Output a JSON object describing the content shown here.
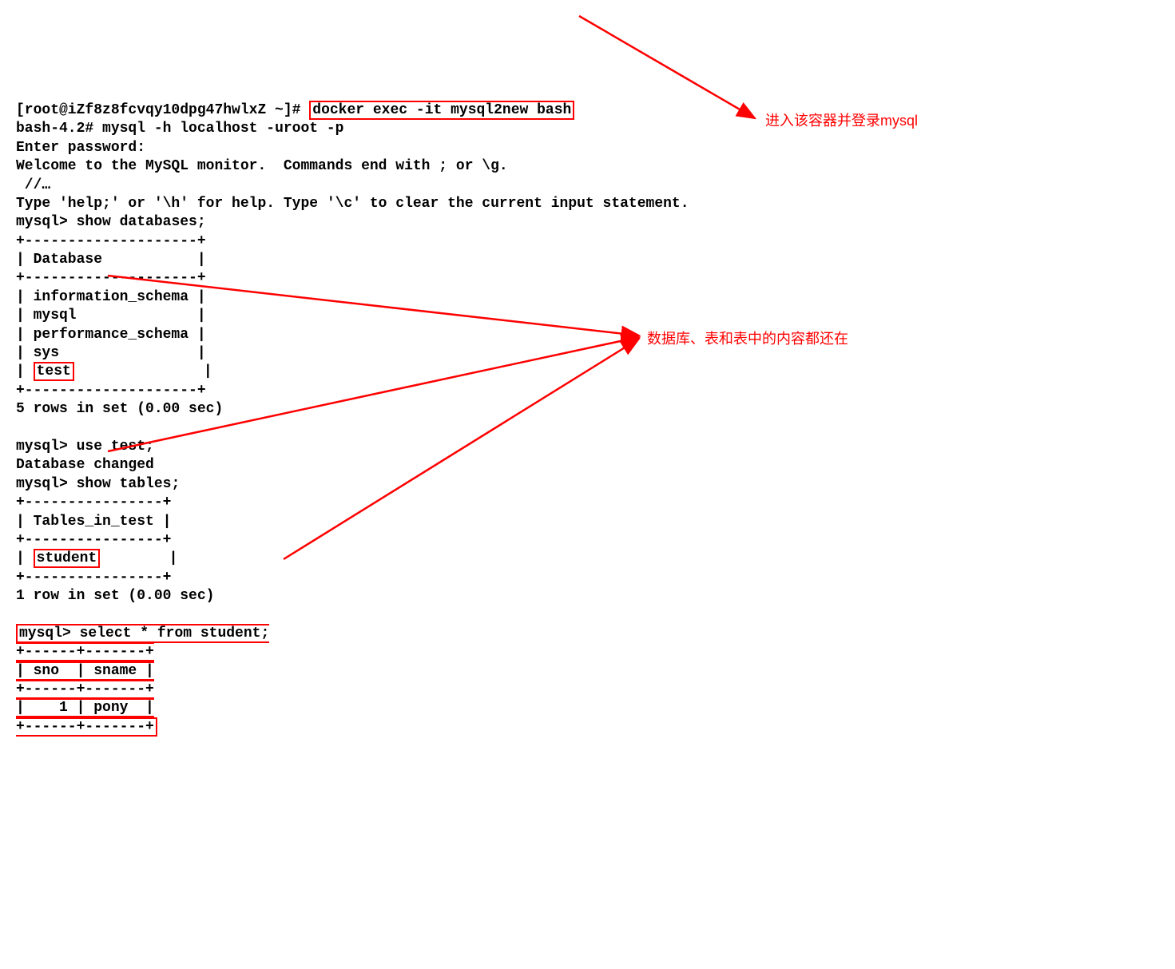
{
  "term": {
    "prompt1": "[root@iZf8z8fcvqy10dpg47hwlxZ ~]# ",
    "cmd1": "docker exec -it mysql2new bash",
    "bash_prompt": "bash-4.2# ",
    "cmd2": "mysql -h localhost -uroot -p",
    "enter_pw": "Enter password:",
    "welcome": "Welcome to the MySQL monitor.  Commands end with ; or \\g.",
    "ellipsis": " //…",
    "help": "Type 'help;' or '\\h' for help. Type '\\c' to clear the current input statement.",
    "mysql_prompt": "mysql> ",
    "show_db": "show databases;",
    "db_sep": "+--------------------+",
    "db_head": "| Database           |",
    "db_row1": "| information_schema |",
    "db_row2": "| mysql              |",
    "db_row3": "| performance_schema |",
    "db_row4": "| sys                |",
    "db_row5_pre": "| ",
    "db_row5_val": "test",
    "db_row5_post": "               |",
    "db_count": "5 rows in set (0.00 sec)",
    "use_test": "use test;",
    "db_changed": "Database changed",
    "show_tables": "show tables;",
    "tbl_sep": "+----------------+",
    "tbl_head": "| Tables_in_test |",
    "tbl_row_pre": "| ",
    "tbl_row_val": "student",
    "tbl_row_post": "        |",
    "tbl_count": "1 row in set (0.00 sec)",
    "select": "select * from student;",
    "res_sep": "+------+-------+",
    "res_head": "| sno  | sname |",
    "res_row": "|    1 | pony  |"
  },
  "annotations": {
    "a1": "进入该容器并登录mysql",
    "a2": "数据库、表和表中的内容都还在"
  }
}
